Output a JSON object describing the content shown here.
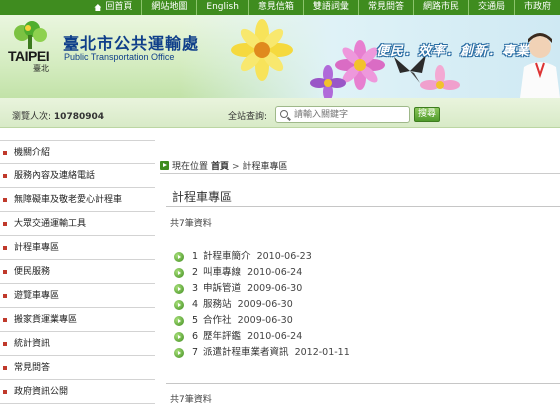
{
  "topnav": {
    "items": [
      "回首頁",
      "網站地圖",
      "English",
      "意見信箱",
      "雙語詞彙",
      "常見問答",
      "網路市民",
      "交通局",
      "市政府"
    ]
  },
  "header": {
    "logo_text": "TAIPEI",
    "logo_sub": "臺北",
    "org_name_zh": "臺北市公共運輸處",
    "org_name_en": "Public Transportation Office",
    "slogan": "便民．效率．創新．專業"
  },
  "subbar": {
    "visitor_label": "瀏覽人次:",
    "visitor_count": "10780904",
    "search_label": "全站查詢:",
    "search_placeholder": "請輸入關鍵字",
    "search_button": "搜尋"
  },
  "sidebar": {
    "items": [
      "機關介紹",
      "服務內容及連絡電話",
      "無障礙車及敬老愛心計程車",
      "大眾交通運輸工具",
      "計程車專區",
      "便民服務",
      "遊覽車專區",
      "搬家貨運業專區",
      "統計資訊",
      "常見問答",
      "政府資訊公開"
    ]
  },
  "main": {
    "crumb_prefix": "現在位置",
    "crumb_home": "首頁",
    "crumb_sep": ">",
    "crumb_current": "計程車專區",
    "title": "計程車專區",
    "count_text": "共7筆資料",
    "rows": [
      {
        "num": "1",
        "title": "計程車簡介",
        "date": "2010-06-23"
      },
      {
        "num": "2",
        "title": "叫車專線",
        "date": "2010-06-24"
      },
      {
        "num": "3",
        "title": "申訴管道",
        "date": "2009-06-30"
      },
      {
        "num": "4",
        "title": "服務站",
        "date": "2009-06-30"
      },
      {
        "num": "5",
        "title": "合作社",
        "date": "2009-06-30"
      },
      {
        "num": "6",
        "title": "歷年評鑑",
        "date": "2010-06-24"
      },
      {
        "num": "7",
        "title": "派遣計程車業者資訊",
        "date": "2012-01-11"
      }
    ]
  }
}
